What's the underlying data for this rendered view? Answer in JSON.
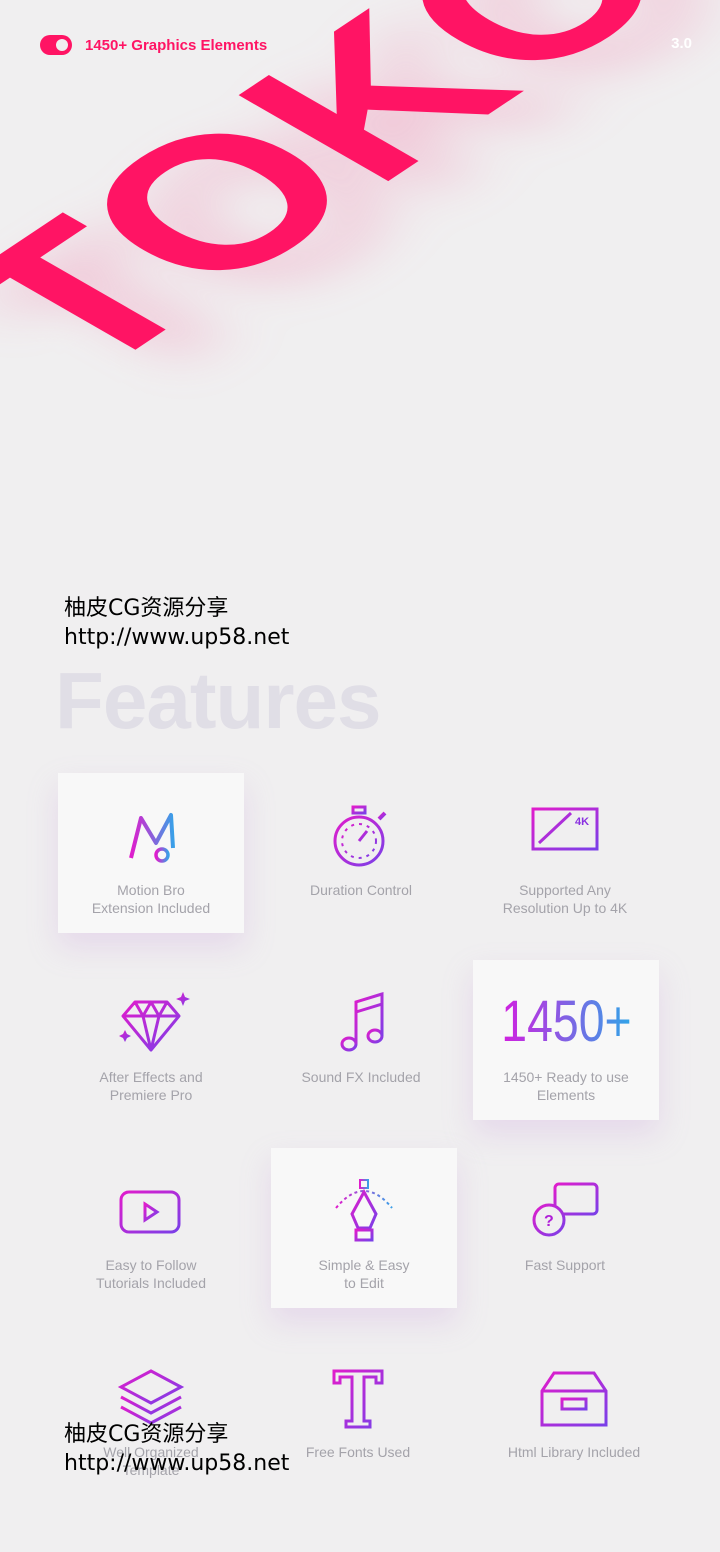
{
  "header": {
    "tagline": "1450+ Graphics Elements",
    "version": "3.0",
    "hero_text": "TOKO"
  },
  "colors": {
    "accent": "#ff1464",
    "gradient_start": "#e01ccc",
    "gradient_end": "#7a3fe8"
  },
  "watermark": {
    "line1": "柚皮CG资源分享",
    "line2": "http://www.up58.net"
  },
  "section_title": "Features",
  "features": [
    {
      "icon": "motion-bro-icon",
      "label": [
        "Motion Bro",
        "Extension Included"
      ],
      "highlighted": true
    },
    {
      "icon": "stopwatch-icon",
      "label": [
        "Duration Control"
      ],
      "highlighted": false
    },
    {
      "icon": "monitor-4k-icon",
      "label": [
        "Supported Any",
        "Resolution Up to 4K"
      ],
      "highlighted": false,
      "badge": "4K"
    },
    {
      "icon": "diamond-icon",
      "label": [
        "After Effects and",
        "Premiere Pro"
      ],
      "highlighted": false
    },
    {
      "icon": "music-note-icon",
      "label": [
        "Sound FX Included"
      ],
      "highlighted": false
    },
    {
      "icon": "count-1450",
      "big": "1450+",
      "label": [
        "1450+ Ready to use",
        "Elements"
      ],
      "highlighted": true
    },
    {
      "icon": "video-play-icon",
      "label": [
        "Easy to Follow",
        "Tutorials Included"
      ],
      "highlighted": false
    },
    {
      "icon": "pen-tool-icon",
      "label": [
        "Simple & Easy",
        "to Edit"
      ],
      "highlighted": true
    },
    {
      "icon": "chat-support-icon",
      "label": [
        "Fast Support"
      ],
      "highlighted": false
    },
    {
      "icon": "layers-icon",
      "label": [
        "Well Organized",
        "Template"
      ],
      "highlighted": false
    },
    {
      "icon": "font-icon",
      "label": [
        "Free Fonts Used"
      ],
      "highlighted": false
    },
    {
      "icon": "archive-box-icon",
      "label": [
        "Html Library Included"
      ],
      "highlighted": false
    }
  ]
}
